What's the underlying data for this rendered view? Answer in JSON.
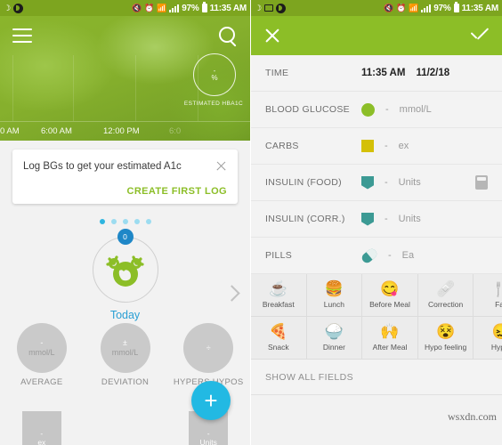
{
  "status_bar": {
    "icons": [
      "moon-icon",
      "message-icon",
      "app-icon",
      "mute-icon",
      "alarm-icon",
      "wifi-icon",
      "signal-icon"
    ],
    "battery": "97%",
    "time": "11:35 AM"
  },
  "left": {
    "appbar": {
      "menu": "menu-icon",
      "search": "search-icon"
    },
    "chart": {
      "hba1c_value": "-",
      "hba1c_percent": "%",
      "hba1c_caption": "ESTIMATED HBA1C",
      "axis_labels": [
        "0 AM",
        "6:00 AM",
        "12:00 PM",
        "6:0"
      ]
    },
    "notification": {
      "message": "Log BGs to get your estimated A1c",
      "cta": "CREATE FIRST LOG",
      "close": "close-icon"
    },
    "carousel": {
      "badge": "0",
      "label": "Today",
      "dots": 5,
      "active_dot": 0,
      "next": "chevron-right-icon"
    },
    "stats": [
      {
        "value": "-",
        "unit": "mmol/L",
        "label": "AVERAGE",
        "symbol": ""
      },
      {
        "value": "-",
        "unit": "mmol/L",
        "label": "DEVIATION",
        "symbol": "±"
      },
      {
        "value": "-",
        "unit": "-",
        "label": "HYPERS\nHYPOS",
        "symbol": "÷"
      }
    ],
    "stat_labels": [
      "AVERAGE",
      "DEVIATION",
      "HYPERS HYPOS"
    ],
    "bottom_cards": [
      {
        "value": "-",
        "unit": "ex"
      },
      {
        "value": "-",
        "unit": "Units"
      }
    ],
    "fab": "+"
  },
  "right": {
    "appbar": {
      "close": "close-icon",
      "confirm": "check-icon"
    },
    "fields": [
      {
        "label": "TIME",
        "time": "11:35 AM",
        "date": "11/2/18",
        "swatch": "none",
        "value": "",
        "unit": ""
      },
      {
        "label": "BLOOD GLUCOSE",
        "swatch": "circle",
        "color": "#8cbe28",
        "value": "-",
        "unit": "mmol/L"
      },
      {
        "label": "CARBS",
        "swatch": "square",
        "color": "#d4c007",
        "value": "-",
        "unit": "ex"
      },
      {
        "label": "INSULIN (FOOD)",
        "swatch": "pocket",
        "color": "#3c9a94",
        "value": "-",
        "unit": "Units",
        "extra": "calculator-icon"
      },
      {
        "label": "INSULIN (CORR.)",
        "swatch": "pocket",
        "color": "#3c9a94",
        "value": "-",
        "unit": "Units"
      },
      {
        "label": "PILLS",
        "swatch": "pill",
        "color": "#3c9a94",
        "value": "-",
        "unit": "Ea"
      }
    ],
    "tags_row1": [
      {
        "label": "Breakfast",
        "icon": "coffee-cup-icon",
        "glyph": "☕"
      },
      {
        "label": "Lunch",
        "icon": "burger-drink-icon",
        "glyph": "🍔"
      },
      {
        "label": "Before Meal",
        "icon": "face-before-meal-icon",
        "glyph": "😋"
      },
      {
        "label": "Correction",
        "icon": "bandage-icon",
        "glyph": "🩹"
      },
      {
        "label": "Fas",
        "icon": "fasting-icon",
        "glyph": "🍴"
      }
    ],
    "tags_row2": [
      {
        "label": "Snack",
        "icon": "pizza-slice-icon",
        "glyph": "🍕"
      },
      {
        "label": "Dinner",
        "icon": "bowl-icon",
        "glyph": "🍚"
      },
      {
        "label": "After Meal",
        "icon": "face-after-meal-icon",
        "glyph": "🙌"
      },
      {
        "label": "Hypo feeling",
        "icon": "face-hypo-icon",
        "glyph": "😵"
      },
      {
        "label": "Hyper",
        "icon": "face-hyper-icon",
        "glyph": "😖"
      }
    ],
    "show_all": "SHOW ALL FIELDS",
    "watermark": "wsxdn.com"
  }
}
